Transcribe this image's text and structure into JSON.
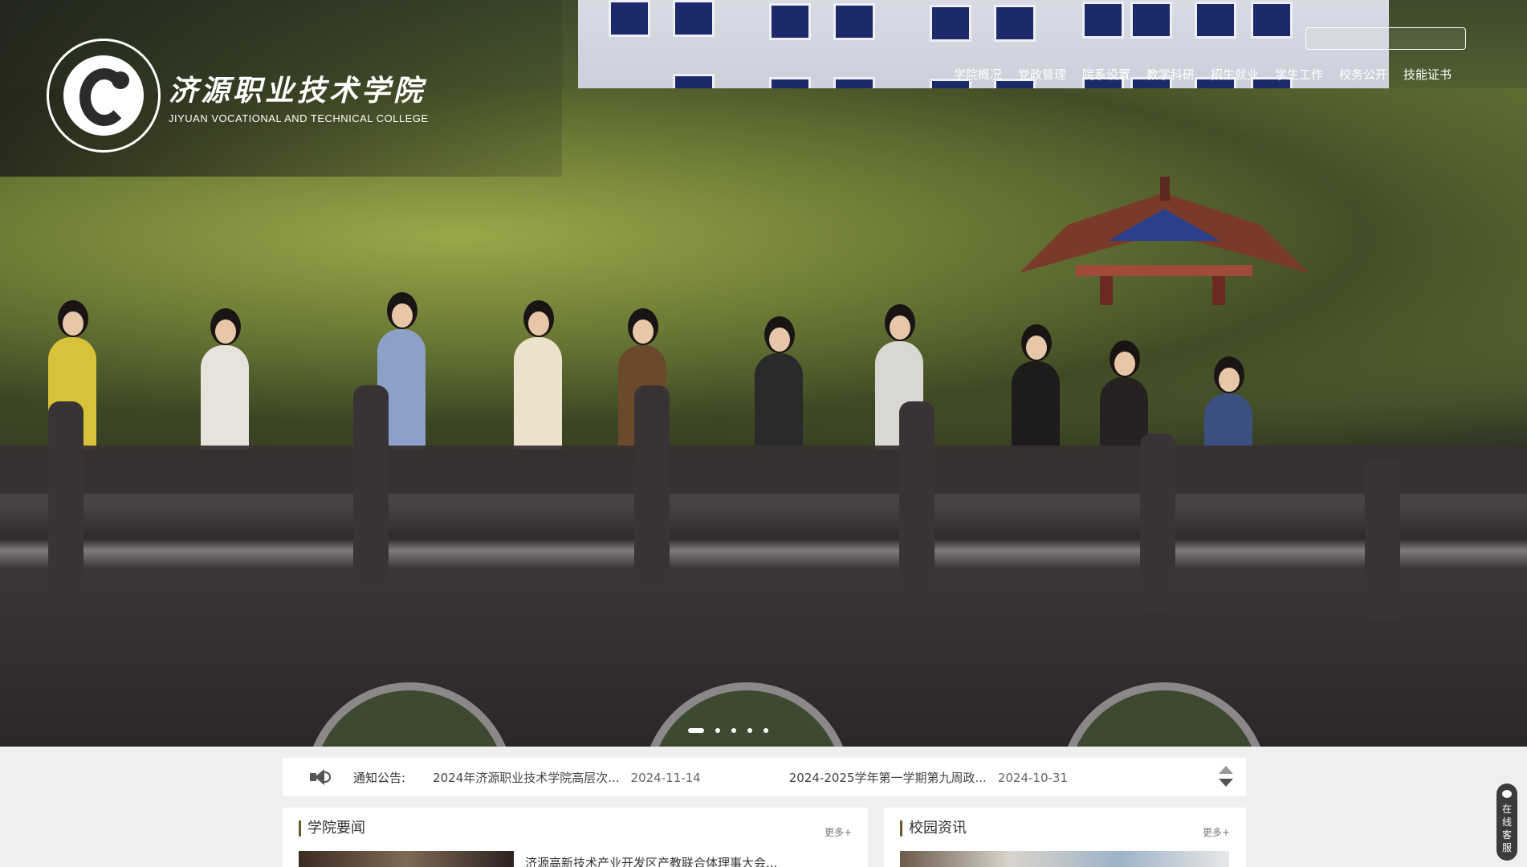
{
  "header": {
    "logo_cn": "济源职业技术学院",
    "logo_en": "JIYUAN VOCATIONAL AND TECHNICAL COLLEGE",
    "search_placeholder": ""
  },
  "nav": {
    "items": [
      {
        "label": "学院概况"
      },
      {
        "label": "党政管理"
      },
      {
        "label": "院系设置"
      },
      {
        "label": "教学科研"
      },
      {
        "label": "招生就业"
      },
      {
        "label": "学生工作"
      },
      {
        "label": "校务公开"
      },
      {
        "label": "技能证书"
      }
    ]
  },
  "slider": {
    "total": 5,
    "active_index": 0
  },
  "notice": {
    "label": "通知公告:",
    "items": [
      {
        "title": "2024年济源职业技术学院高层次...",
        "date": "2024-11-14"
      },
      {
        "title": "2024-2025学年第一学期第九周政...",
        "date": "2024-10-31"
      }
    ]
  },
  "panels": {
    "news": {
      "title": "学院要闻",
      "more": "更多+",
      "first_item": "济源高新技术产业开发区产教联合体理事大会..."
    },
    "campus": {
      "title": "校园资讯",
      "more": "更多+"
    }
  },
  "service": {
    "label": "在线客服"
  },
  "colors": {
    "nav_text": "#ffffff",
    "panel_accent": "#6b5a2a",
    "page_bg": "#efefef"
  }
}
